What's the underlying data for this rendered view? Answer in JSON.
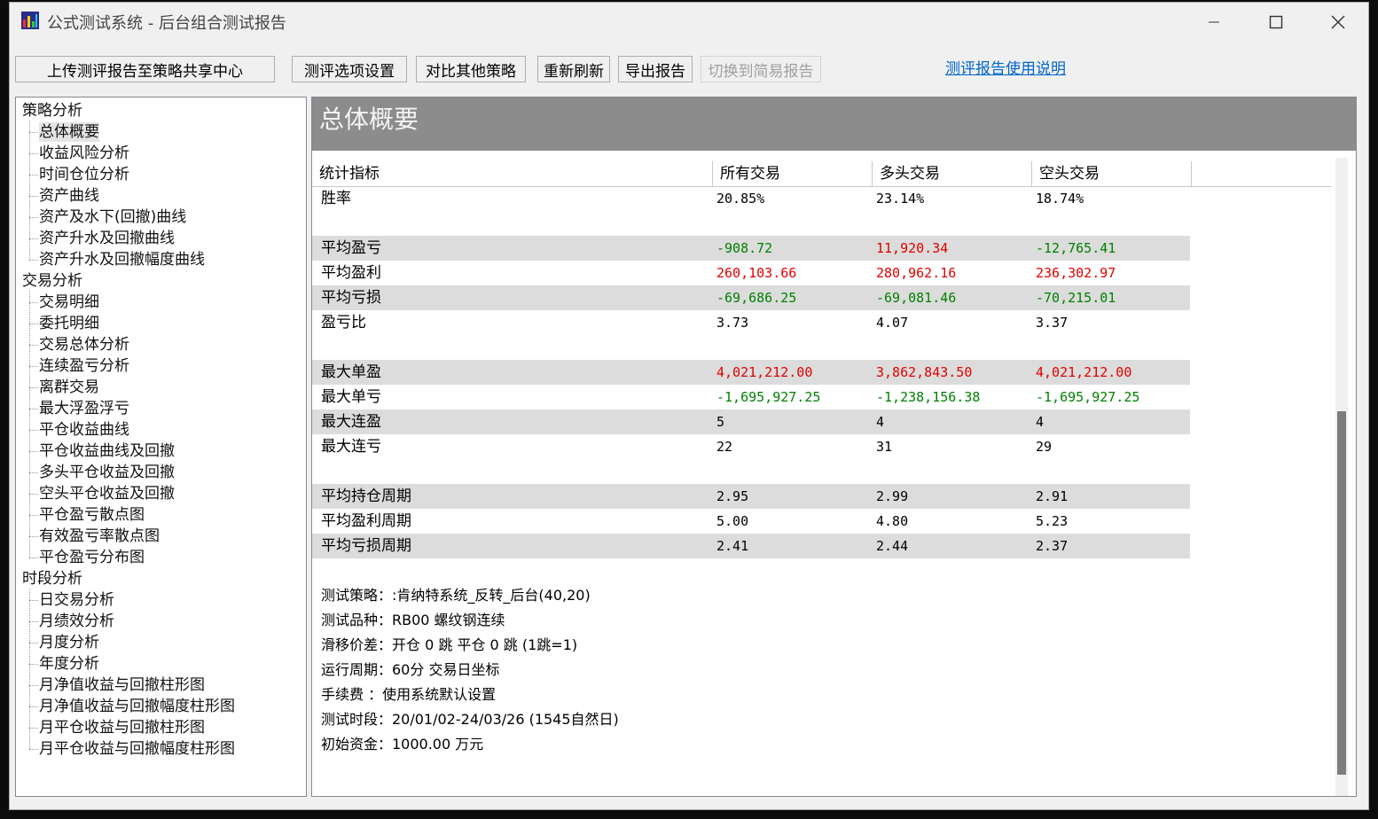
{
  "window": {
    "title": "公式测试系统 - 后台组合测试报告"
  },
  "toolbar": {
    "upload": "上传测评报告至策略共享中心",
    "options": "测评选项设置",
    "compare": "对比其他策略",
    "refresh": "重新刷新",
    "export": "导出报告",
    "simple": "切换到简易报告",
    "help": "测评报告使用说明"
  },
  "tree": {
    "groups": [
      {
        "label": "策略分析",
        "items": [
          "总体概要",
          "收益风险分析",
          "时间仓位分析",
          "资产曲线",
          "资产及水下(回撤)曲线",
          "资产升水及回撤曲线",
          "资产升水及回撤幅度曲线"
        ]
      },
      {
        "label": "交易分析",
        "items": [
          "交易明细",
          "委托明细",
          "交易总体分析",
          "连续盈亏分析",
          "离群交易",
          "最大浮盈浮亏",
          "平仓收益曲线",
          "平仓收益曲线及回撤",
          "多头平仓收益及回撤",
          "空头平仓收益及回撤",
          "平仓盈亏散点图",
          "有效盈亏率散点图",
          "平仓盈亏分布图"
        ]
      },
      {
        "label": "时段分析",
        "items": [
          "日交易分析",
          "月绩效分析",
          "月度分析",
          "年度分析",
          "月净值收益与回撤柱形图",
          "月净值收益与回撤幅度柱形图",
          "月平仓收益与回撤柱形图",
          "月平仓收益与回撤幅度柱形图"
        ]
      }
    ],
    "selected": "总体概要"
  },
  "report": {
    "title": "总体概要",
    "headers": [
      "统计指标",
      "所有交易",
      "多头交易",
      "空头交易"
    ],
    "rows": [
      {
        "label": "胜率",
        "values": [
          "20.85%",
          "23.14%",
          "18.74%"
        ],
        "colors": [
          "#000000",
          "#000000",
          "#000000"
        ]
      },
      {
        "label": "平均盈亏",
        "values": [
          "-908.72",
          "11,920.34",
          "-12,765.41"
        ],
        "colors": [
          "#008000",
          "#e00000",
          "#008000"
        ]
      },
      {
        "label": "平均盈利",
        "values": [
          "260,103.66",
          "280,962.16",
          "236,302.97"
        ],
        "colors": [
          "#e00000",
          "#e00000",
          "#e00000"
        ]
      },
      {
        "label": "平均亏损",
        "values": [
          "-69,686.25",
          "-69,081.46",
          "-70,215.01"
        ],
        "colors": [
          "#008000",
          "#008000",
          "#008000"
        ]
      },
      {
        "label": "盈亏比",
        "values": [
          "3.73",
          "4.07",
          "3.37"
        ],
        "colors": [
          "#000000",
          "#000000",
          "#000000"
        ]
      },
      {
        "label": "最大单盈",
        "values": [
          "4,021,212.00",
          "3,862,843.50",
          "4,021,212.00"
        ],
        "colors": [
          "#e00000",
          "#e00000",
          "#e00000"
        ]
      },
      {
        "label": "最大单亏",
        "values": [
          "-1,695,927.25",
          "-1,238,156.38",
          "-1,695,927.25"
        ],
        "colors": [
          "#008000",
          "#008000",
          "#008000"
        ]
      },
      {
        "label": "最大连盈",
        "values": [
          "5",
          "4",
          "4"
        ],
        "colors": [
          "#000000",
          "#000000",
          "#000000"
        ]
      },
      {
        "label": "最大连亏",
        "values": [
          "22",
          "31",
          "29"
        ],
        "colors": [
          "#000000",
          "#000000",
          "#000000"
        ]
      },
      {
        "label": "平均持仓周期",
        "values": [
          "2.95",
          "2.99",
          "2.91"
        ],
        "colors": [
          "#000000",
          "#000000",
          "#000000"
        ]
      },
      {
        "label": "平均盈利周期",
        "values": [
          "5.00",
          "4.80",
          "5.23"
        ],
        "colors": [
          "#000000",
          "#000000",
          "#000000"
        ]
      },
      {
        "label": "平均亏损周期",
        "values": [
          "2.41",
          "2.44",
          "2.37"
        ],
        "colors": [
          "#000000",
          "#000000",
          "#000000"
        ]
      }
    ],
    "info": [
      "测试策略：:肯纳特系统_反转_后台(40,20)",
      "测试品种：RB00 螺纹钢连续",
      "滑移价差：开仓 0 跳 平仓 0 跳 (1跳=1)",
      "运行周期：60分 交易日坐标",
      "手续费  ：使用系统默认设置",
      "测试时段：20/01/02-24/03/26 (1545自然日)",
      "初始资金：1000.00 万元"
    ]
  }
}
